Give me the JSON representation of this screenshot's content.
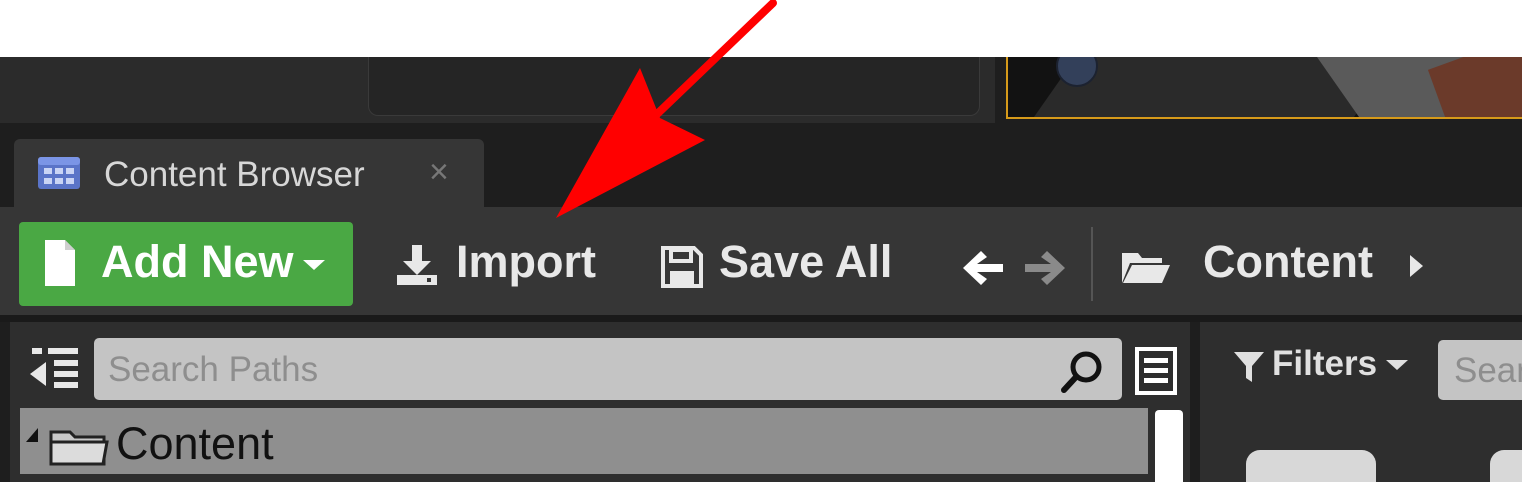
{
  "tab": {
    "title": "Content Browser",
    "close_glyph": "×",
    "icon": "content-browser-icon"
  },
  "toolbar": {
    "add_new_label": "Add New",
    "import_label": "Import",
    "save_all_label": "Save All",
    "breadcrumb_label": "Content",
    "add_new_color": "#4aa844"
  },
  "sources_panel": {
    "search_placeholder": "Search Paths",
    "tree": [
      {
        "label": "Content",
        "expanded": true,
        "selected": true
      }
    ]
  },
  "assets_panel": {
    "filters_label": "Filters",
    "search_placeholder": "Sear"
  },
  "annotation": {
    "arrow_color": "#ff0000",
    "points_to": "Import"
  },
  "colors": {
    "viewport_border": "#d69a1a",
    "panel_bg": "#363636"
  }
}
